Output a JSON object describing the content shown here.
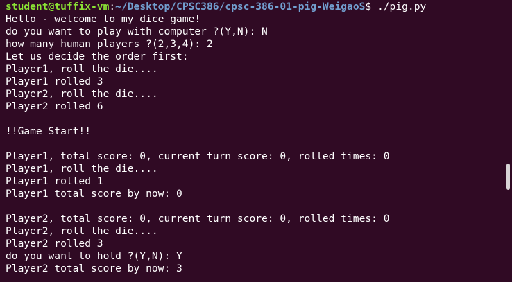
{
  "prompt": {
    "user_host": "student@tuffix-vm",
    "colon": ":",
    "path": "~/Desktop/CPSC386/cpsc-386-01-pig-WeigaoS",
    "suffix": "$ ./pig.py"
  },
  "output_lines": [
    "Hello - welcome to my dice game!",
    "do you want to play with computer ?(Y,N): N",
    "how many human players ?(2,3,4): 2",
    "Let us decide the order first:",
    "Player1, roll the die....",
    "Player1 rolled 3",
    "Player2, roll the die....",
    "Player2 rolled 6",
    "",
    "!!Game Start!!",
    "",
    "Player1, total score: 0, current turn score: 0, rolled times: 0",
    "Player1, roll the die....",
    "Player1 rolled 1",
    "Player1 total score by now: 0",
    "",
    "Player2, total score: 0, current turn score: 0, rolled times: 0",
    "Player2, roll the die....",
    "Player2 rolled 3",
    "do you want to hold ?(Y,N): Y",
    "Player2 total score by now: 3"
  ],
  "colors": {
    "background": "#300a24",
    "prompt_user": "#8ae234",
    "prompt_path": "#729fcf",
    "text": "#ffffff"
  }
}
